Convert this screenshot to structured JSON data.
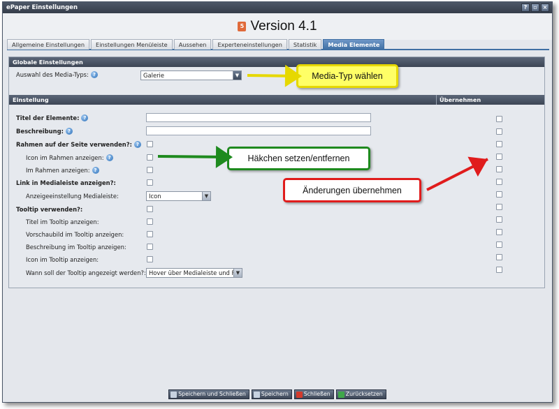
{
  "window": {
    "title": "ePaper Einstellungen"
  },
  "version": {
    "label": "Version 4.1"
  },
  "tabs": [
    {
      "label": "Allgemeine Einstellungen"
    },
    {
      "label": "Einstellungen Menüleiste"
    },
    {
      "label": "Aussehen"
    },
    {
      "label": "Experteneinstellungen"
    },
    {
      "label": "Statistik"
    },
    {
      "label": "Media Elemente",
      "active": true
    }
  ],
  "global": {
    "header": "Globale Einstellungen",
    "media_type_label": "Auswahl des Media-Typs:",
    "media_type_value": "Galerie"
  },
  "table": {
    "col_setting": "Einstellung",
    "col_apply": "Übernehmen"
  },
  "rows": {
    "title_elements": "Titel der Elemente:",
    "description": "Beschreibung:",
    "frame_on_page": "Rahmen auf der Seite verwenden?:",
    "icon_in_frame": "Icon im Rahmen anzeigen:",
    "in_frame": "Im Rahmen anzeigen:",
    "link_medialeiste": "Link in Medialeiste anzeigen?:",
    "display_setting_medialeiste": "Anzeigeeinstellung Medialeiste:",
    "display_setting_value": "Icon",
    "tooltip_use": "Tooltip verwenden?:",
    "tooltip_title": "Titel im Tooltip anzeigen:",
    "tooltip_preview": "Vorschaubild im Tooltip anzeigen:",
    "tooltip_description": "Beschreibung im Tooltip anzeigen:",
    "tooltip_icon": "Icon im Tooltip anzeigen:",
    "tooltip_when": "Wann soll der Tooltip angezeigt werden?:",
    "tooltip_when_value": "Hover über Medialeiste und Ral"
  },
  "callouts": {
    "media_type": "Media-Typ wählen",
    "checkbox": "Häkchen setzen/entfernen",
    "apply": "Änderungen übernehmen"
  },
  "footer": {
    "save_close": "Speichern und Schließen",
    "save": "Speichern",
    "close": "Schließen",
    "reset": "Zurücksetzen"
  },
  "colors": {
    "tab_active": "#3f6fa3",
    "callout_yellow": "#ffff66",
    "callout_green_border": "#1e8a1e",
    "callout_red_border": "#e01c1c"
  }
}
